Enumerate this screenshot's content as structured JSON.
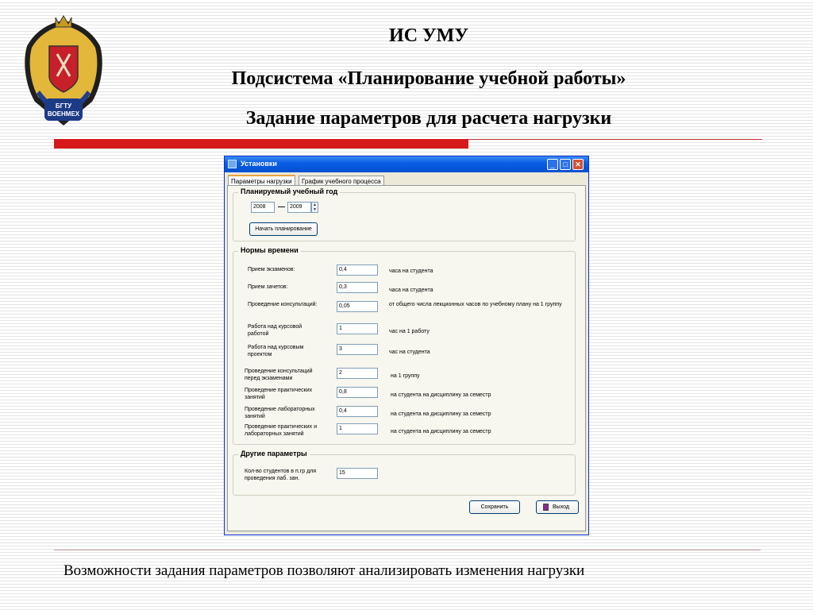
{
  "slide": {
    "title1": "ИС УМУ",
    "title2": "Подсистема «Планирование учебной работы»",
    "title3": "Задание параметров для расчета нагрузки",
    "caption": "Возможности задания параметров позволяют анализировать изменения нагрузки",
    "logo_text": "БГТУ ВОЕНМЕХ",
    "accent_color": "#d61a1a"
  },
  "window": {
    "title": "Установки",
    "tabs": [
      "Параметры нагрузки",
      "График учебного процесса"
    ],
    "group_year": {
      "title": "Планируемый учебный год",
      "year_from": "2008",
      "year_to": "2009",
      "start_button": "Начать планирование"
    },
    "group_norms": {
      "title": "Нормы времени",
      "rows": [
        {
          "label": "Прием экзаменов:",
          "value": "0,4",
          "unit": "часа на студента"
        },
        {
          "label": "Прием зачетов:",
          "value": "0,3",
          "unit": "часа на студента"
        },
        {
          "label": "Проведение консультаций:",
          "value": "0,05",
          "unit": "от общего числа лекционных часов по учебному плану на 1 группу"
        },
        {
          "label": "Работа над курсовой работой",
          "value": "1",
          "unit": "час на 1 работу"
        },
        {
          "label": "Работа над курсовым проектом",
          "value": "3",
          "unit": "час на студента"
        },
        {
          "label": "Проведение консультаций перед экзаменами",
          "value": "2",
          "unit": "на 1 группу"
        },
        {
          "label": "Проведение практических занятий",
          "value": "0,8",
          "unit": "на студента на дисциплину за семестр"
        },
        {
          "label": "Проведение лабораторных занятий",
          "value": "0,4",
          "unit": "на студента на дисциплину за семестр"
        },
        {
          "label": "Проведение практических и лабораторных занятий",
          "value": "1",
          "unit": "на студента на дисциплину за семестр"
        }
      ]
    },
    "group_other": {
      "title": "Другие параметры",
      "label": "Кол-во студентов в п.гр для проведения лаб. зан.",
      "value": "15"
    },
    "save_button": "Сохранить",
    "exit_button": "Выход"
  }
}
